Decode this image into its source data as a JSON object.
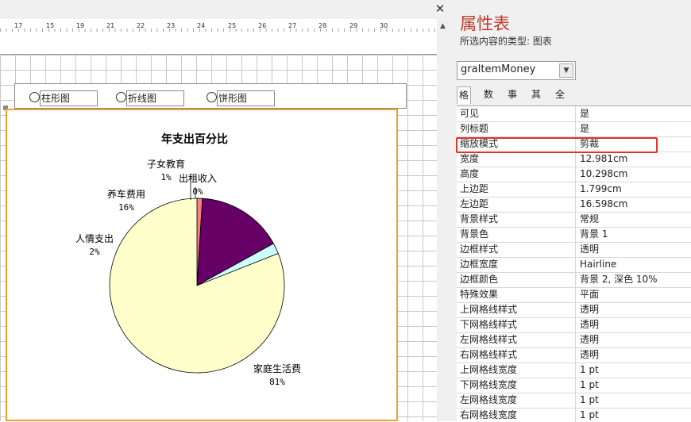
{
  "window": {
    "close_glyph": "✕"
  },
  "ruler": {
    "labels": [
      "17",
      "15",
      "19",
      "21",
      "22",
      "23",
      "24",
      "25",
      "26",
      "27",
      "28",
      "29",
      "30"
    ]
  },
  "radios": [
    {
      "label": "柱形图"
    },
    {
      "label": "折线图"
    },
    {
      "label": "饼形图"
    }
  ],
  "chart_data": {
    "type": "pie",
    "title": "年支出百分比",
    "slices": [
      {
        "name": "家庭生活费",
        "value": 81,
        "label": "81%",
        "color": "#ffffcc"
      },
      {
        "name": "人情支出",
        "value": 2,
        "label": "2%",
        "color": "#ccffff"
      },
      {
        "name": "养车费用",
        "value": 16,
        "label": "16%",
        "color": "#660066"
      },
      {
        "name": "子女教育",
        "value": 1,
        "label": "1%",
        "color": "#ff8080"
      },
      {
        "name": "出租收入",
        "value": 0,
        "label": "0%",
        "color": "#ffffff"
      }
    ]
  },
  "properties": {
    "title": "属性表",
    "type_label": "所选内容的类型: 图表",
    "control_name": "graItemMoney",
    "tabs": [
      "格式",
      "数据",
      "事件",
      "其他",
      "全部"
    ],
    "highlight_color": "#e0332a",
    "rows": [
      {
        "key": "可见",
        "value": "是"
      },
      {
        "key": "列标题",
        "value": "是"
      },
      {
        "key": "缩放模式",
        "value": "剪裁"
      },
      {
        "key": "宽度",
        "value": "12.981cm"
      },
      {
        "key": "高度",
        "value": "10.298cm"
      },
      {
        "key": "上边距",
        "value": "1.799cm"
      },
      {
        "key": "左边距",
        "value": "16.598cm"
      },
      {
        "key": "背景样式",
        "value": "常规"
      },
      {
        "key": "背景色",
        "value": "背景 1"
      },
      {
        "key": "边框样式",
        "value": "透明"
      },
      {
        "key": "边框宽度",
        "value": "Hairline"
      },
      {
        "key": "边框颜色",
        "value": "背景 2, 深色 10%"
      },
      {
        "key": "特殊效果",
        "value": "平面"
      },
      {
        "key": "上网格线样式",
        "value": "透明"
      },
      {
        "key": "下网格线样式",
        "value": "透明"
      },
      {
        "key": "左网格线样式",
        "value": "透明"
      },
      {
        "key": "右网格线样式",
        "value": "透明"
      },
      {
        "key": "上网格线宽度",
        "value": "1 pt"
      },
      {
        "key": "下网格线宽度",
        "value": "1 pt"
      },
      {
        "key": "左网格线宽度",
        "value": "1 pt"
      },
      {
        "key": "右网格线宽度",
        "value": "1 pt"
      }
    ]
  }
}
